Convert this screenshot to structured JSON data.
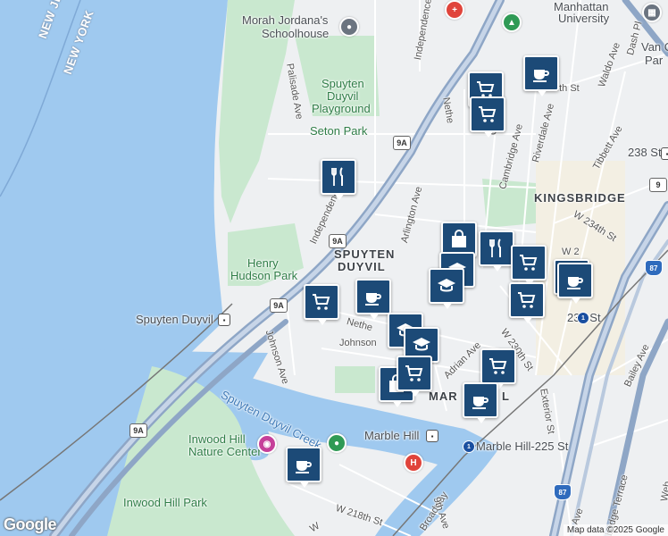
{
  "labels": {
    "morah": "Morah Jordana's",
    "morah2": "Schoolhouse",
    "manhattan_univ": "Manhattan",
    "manhattan_univ2": "University",
    "van": "Van C",
    "van2": "Par",
    "spuyten_playground": "Spuyten",
    "spuyten_playground2": "Duyvil",
    "spuyten_playground3": "Playground",
    "seton_park": "Seton Park",
    "henry_hudson_park": "Henry",
    "henry_hudson_park2": "Hudson Park",
    "spuyten_duyvil_station": "Spuyten Duyvil",
    "spuyten_duyvil_hood": "SPUYTEN",
    "spuyten_duyvil_hood2": "DUYVIL",
    "kingsbridge": "KINGSBRIDGE",
    "marble_hill_hood": "MAR",
    "marble_hill_hood2": "L",
    "inwood_nature": "Inwood Hill",
    "inwood_nature2": "Nature Center",
    "inwood_park": "Inwood Hill Park",
    "spuyten_creek": "Spuyten Duyvil Creek",
    "marble_hill_station": "Marble Hill",
    "marble_hill_225": "Marble Hill-225 St",
    "st_238": "238 St",
    "st_231": "231 St",
    "new_jersey": "NEW JERSEY",
    "new_york": "NEW YORK"
  },
  "streets": {
    "palisade": "Palisade Ave",
    "independence_n": "Independence",
    "independence_s": "Independence",
    "arlington": "Arlington Ave",
    "johnson_w": "Johnson Ave",
    "johnson_e": "Johnson",
    "nether_n": "Nethe",
    "nether_s": "Nethe",
    "oxford": "Oxfo",
    "cambridge": "Cambridge Ave",
    "riverdale": "Riverdale Ave",
    "tibbett": "Tibbett Ave",
    "waldo": "Waldo Ave",
    "dash": "Dash Pl",
    "w238": "8th St",
    "w234": "W 234th St",
    "w230": "W 230th St",
    "adrian": "Adrian Ave",
    "exterior": "Exterior St",
    "bailey": "Bailey Ave",
    "broadway": "Broadway",
    "ninth": "9th Ave",
    "w218": "W 218th St",
    "bridge_terrace": "bridge Terrace",
    "ave": "Ave",
    "w2": "W 2",
    "wv": "W",
    "web": "Web"
  },
  "highways": {
    "r9a_1": "9A",
    "r9a_2": "9A",
    "r9a_3": "9A",
    "r9a_4": "9A",
    "r9": "9",
    "i87_1": "87",
    "i87_2": "87"
  },
  "pins": [
    {
      "icon": "cafe-icon"
    },
    {
      "icon": "shopping-cart-icon"
    },
    {
      "icon": "shopping-cart-icon"
    },
    {
      "icon": "restaurant-icon"
    },
    {
      "icon": "shopping-bag-icon"
    },
    {
      "icon": "restaurant-icon"
    },
    {
      "icon": "shopping-cart-icon"
    },
    {
      "icon": "school-icon"
    },
    {
      "icon": "school-icon"
    },
    {
      "icon": "cafe-icon"
    },
    {
      "icon": "shopping-cart-icon"
    },
    {
      "icon": "shopping-cart-icon"
    },
    {
      "icon": "shopping-cart-icon"
    },
    {
      "icon": "cafe-icon"
    },
    {
      "icon": "school-icon"
    },
    {
      "icon": "school-icon"
    },
    {
      "icon": "shopping-cart-icon"
    },
    {
      "icon": "shopping-bag-icon"
    },
    {
      "icon": "shopping-cart-icon"
    },
    {
      "icon": "cafe-icon"
    },
    {
      "icon": "cafe-icon"
    }
  ],
  "attribution": {
    "logo": "Google",
    "text": "Map data ©2025 Google"
  },
  "colors": {
    "land": "#eef0f2",
    "water": "#9fc9ef",
    "park": "#c9e8cf",
    "highway": "#a8bcd6",
    "pin": "#1c4a77"
  }
}
